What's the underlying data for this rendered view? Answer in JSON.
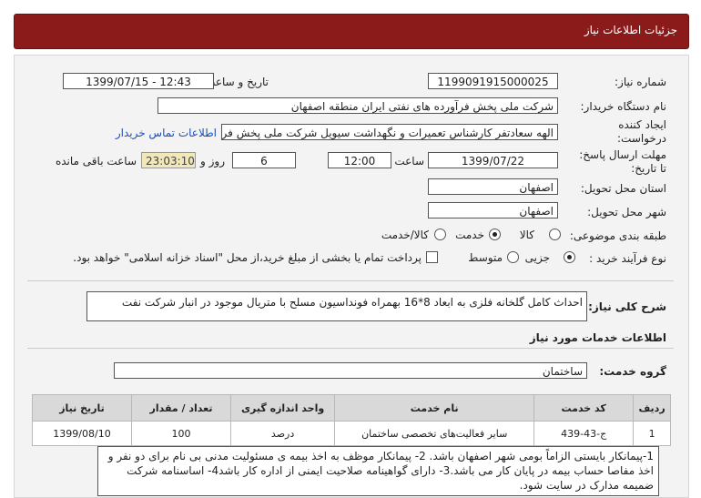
{
  "header": {
    "title": "جزئیات اطلاعات نیاز"
  },
  "form": {
    "need_number": {
      "label": "شماره نیاز:",
      "value": "1199091915000025"
    },
    "announce": {
      "label": "تاریخ و ساعت اعلان عمومی:",
      "value": "1399/07/15 - 12:43"
    },
    "buyer": {
      "label": "نام دستگاه خریدار:",
      "value": "شرکت ملی پخش فرآورده های نفتی ایران منطقه اصفهان"
    },
    "creator": {
      "label1": "ایجاد کننده",
      "label2": "درخواست:",
      "value": "الهه سعادتفر کارشناس تعمیرات و نگهداشت سیویل شرکت ملی پخش فرآورده",
      "contact_link": "اطلاعات تماس خریدار"
    },
    "deadline": {
      "label1": "مهلت ارسال پاسخ:",
      "label2": "تا تاریخ:",
      "date": "1399/07/22",
      "time_label": "ساعت",
      "time": "12:00",
      "days": "6",
      "days_label": "روز و",
      "remaining": "23:03:10",
      "remaining_label": "ساعت باقی مانده"
    },
    "province": {
      "label": "استان محل تحویل:",
      "value": "اصفهان"
    },
    "city": {
      "label": "شهر محل تحویل:",
      "value": "اصفهان"
    },
    "category": {
      "label": "طبقه بندی موضوعی:",
      "options": [
        "کالا",
        "خدمت",
        "کالا/خدمت"
      ],
      "selected": "خدمت"
    },
    "purchase_type": {
      "label": "نوع فرآیند خرید :",
      "options": [
        "جزیی",
        "متوسط"
      ],
      "selected": "جزیی",
      "checkbox_text": "پرداخت تمام یا بخشی از مبلغ خرید،از محل \"اسناد خزانه اسلامی\" خواهد بود."
    }
  },
  "summary": {
    "label": "شرح کلی نیاز:",
    "value": "احداث کامل گلخانه فلزی به ابعاد 8*16 بهمراه فونداسیون مسلح با متریال موجود در انبار شرکت نفت"
  },
  "services": {
    "section_title": "اطلاعات خدمات مورد نیاز",
    "group_label": "گروه خدمت:",
    "group_value": "ساختمان",
    "columns": [
      "ردیف",
      "کد خدمت",
      "نام خدمت",
      "واحد اندازه گیری",
      "تعداد / مقدار",
      "تاریخ نیاز"
    ],
    "rows": [
      [
        "1",
        "ج-43-439",
        "سایر فعالیت‌های تخصصی ساختمان",
        "درصد",
        "100",
        "1399/08/10"
      ]
    ]
  },
  "buyer_notes": {
    "text": "1-پیمانکار بایستی الزاماً بومی شهر اصفهان باشد. 2- پیمانکار موظف به اخذ بیمه ی مسئولیت مدنی بی نام برای دو نفر و اخذ مفاصا حساب بیمه در پایان کار می باشد.3- دارای گواهینامه صلاحیت ایمنی از اداره کار باشد4- اساسنامه شرکت ضمیمه مدارک در سایت شود."
  }
}
